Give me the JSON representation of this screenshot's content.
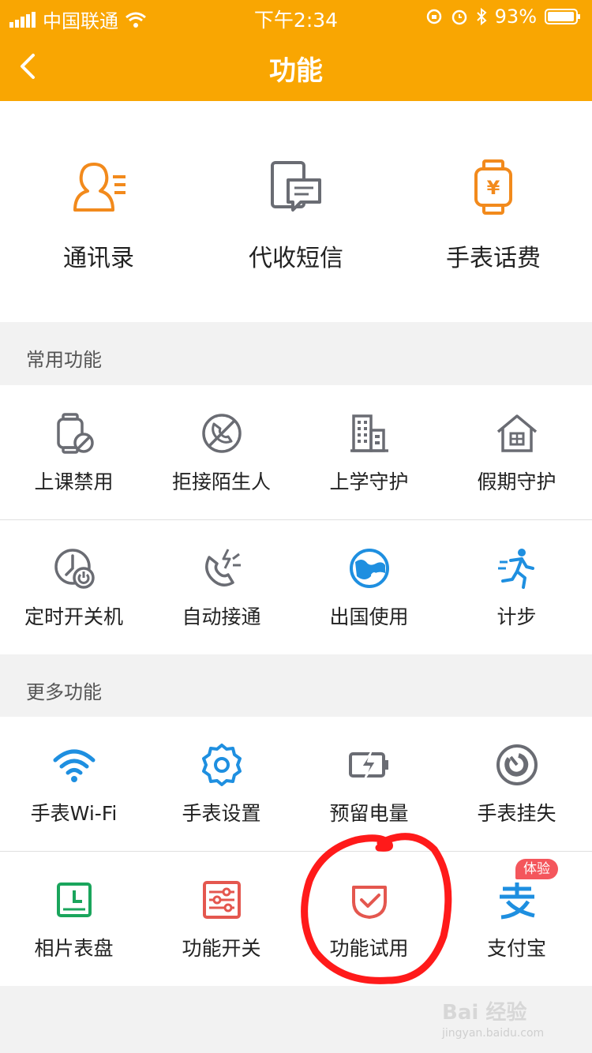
{
  "status_bar": {
    "carrier": "中国联通",
    "time": "下午2:34",
    "battery": "93%"
  },
  "nav": {
    "title": "功能"
  },
  "top_features": [
    {
      "label": "通讯录",
      "icon": "contact-icon"
    },
    {
      "label": "代收短信",
      "icon": "sms-icon"
    },
    {
      "label": "手表话费",
      "icon": "watch-fee-icon"
    }
  ],
  "common": {
    "title": "常用功能",
    "row1": [
      {
        "label": "上课禁用",
        "icon": "class-disable-icon"
      },
      {
        "label": "拒接陌生人",
        "icon": "reject-stranger-icon"
      },
      {
        "label": "上学守护",
        "icon": "school-guard-icon"
      },
      {
        "label": "假期守护",
        "icon": "holiday-guard-icon"
      }
    ],
    "row2": [
      {
        "label": "定时开关机",
        "icon": "timer-power-icon"
      },
      {
        "label": "自动接通",
        "icon": "auto-answer-icon"
      },
      {
        "label": "出国使用",
        "icon": "globe-icon"
      },
      {
        "label": "计步",
        "icon": "runner-icon"
      }
    ]
  },
  "more": {
    "title": "更多功能",
    "row1": [
      {
        "label": "手表Wi-Fi",
        "icon": "wifi-icon"
      },
      {
        "label": "手表设置",
        "icon": "settings-gear-icon"
      },
      {
        "label": "预留电量",
        "icon": "battery-charge-icon"
      },
      {
        "label": "手表挂失",
        "icon": "lost-watch-icon"
      }
    ],
    "row2": [
      {
        "label": "相片表盘",
        "icon": "photo-dial-icon"
      },
      {
        "label": "功能开关",
        "icon": "toggle-settings-icon"
      },
      {
        "label": "功能试用",
        "icon": "trial-icon"
      },
      {
        "label": "支付宝",
        "icon": "alipay-icon"
      }
    ],
    "badge": "体验"
  },
  "colors": {
    "header": "#f9a602",
    "orange_icon": "#f28a1c",
    "gray_icon": "#6a6c73",
    "blue_icon": "#1e8fe0",
    "red_icon": "#e4574f",
    "green_icon": "#1aa55c",
    "annotation": "#ff1a1a"
  },
  "watermark": {
    "brand": "Bai 经验",
    "url": "jingyan.baidu.com"
  }
}
